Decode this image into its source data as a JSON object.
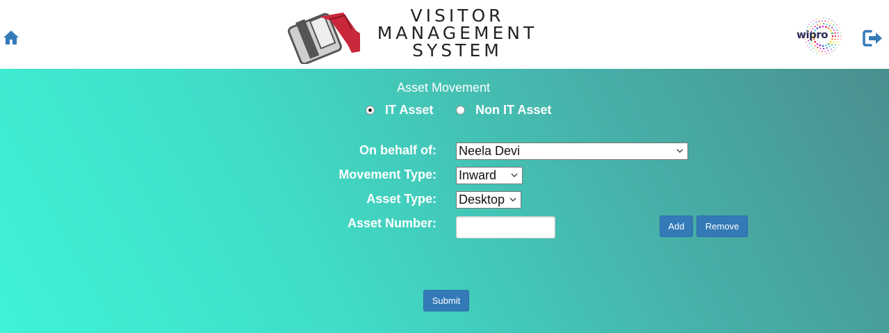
{
  "header": {
    "logo_lines": [
      "VISITOR",
      "MANAGEMENT",
      "SYSTEM"
    ],
    "brand": "wipro",
    "home_icon": "home-icon",
    "logout_icon": "sign-out-icon"
  },
  "colors": {
    "accent": "#337ab7",
    "gradient_start": "#3ff3d6",
    "gradient_end": "#4a8f8f",
    "logo_red": "#c8283a"
  },
  "form": {
    "title": "Asset Movement",
    "radio_options": [
      {
        "label": "IT Asset",
        "checked": true
      },
      {
        "label": "Non IT Asset",
        "checked": false
      }
    ],
    "fields": {
      "on_behalf_label": "On behalf of:",
      "on_behalf_value": "Neela Devi",
      "movement_type_label": "Movement Type:",
      "movement_type_value": "Inward",
      "asset_type_label": "Asset Type:",
      "asset_type_value": "Desktop",
      "asset_number_label": "Asset Number:",
      "asset_number_value": ""
    },
    "add_label": "Add",
    "remove_label": "Remove",
    "submit_label": "Submit"
  }
}
